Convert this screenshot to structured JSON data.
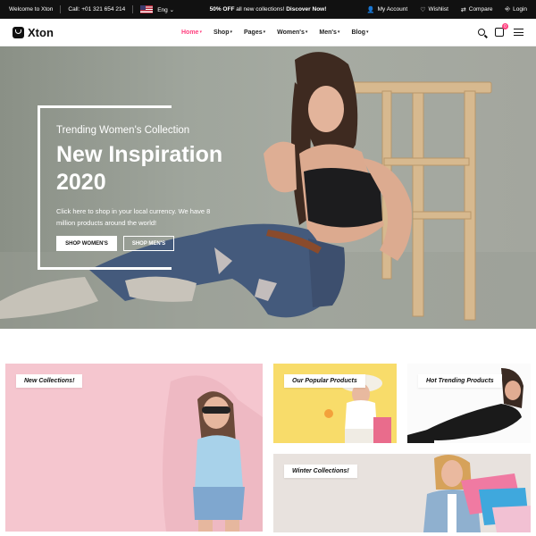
{
  "topbar": {
    "welcome": "Welcome to Xton",
    "call": "Call: +01 321 654 214",
    "language": "Eng",
    "promo_bold": "50% OFF",
    "promo_text": " all new collections! ",
    "promo_link": "Discover Now!",
    "my_account": "My Account",
    "wishlist": "Wishlist",
    "compare": "Compare",
    "login": "Login"
  },
  "nav": {
    "logo": "Xton",
    "menu": {
      "home": "Home",
      "shop": "Shop",
      "pages": "Pages",
      "womens": "Women's",
      "mens": "Men's",
      "blog": "Blog"
    },
    "cart_count": "0"
  },
  "hero": {
    "subtitle": "Trending Women's Collection",
    "title": "New Inspiration 2020",
    "text": "Click here to shop in your local currency. We have 8 million products around the world!",
    "btn_women": "SHOP WOMEN'S",
    "btn_men": "SHOP MEN'S"
  },
  "banners": {
    "new": "New Collections!",
    "popular": "Our Popular Products",
    "trending": "Hot Trending Products",
    "winter": "Winter Collections!"
  },
  "colors": {
    "accent": "#ff3f7e",
    "topbar": "#111111",
    "banner_pink": "#f5c6cf",
    "banner_yellow": "#f8dc6a"
  }
}
